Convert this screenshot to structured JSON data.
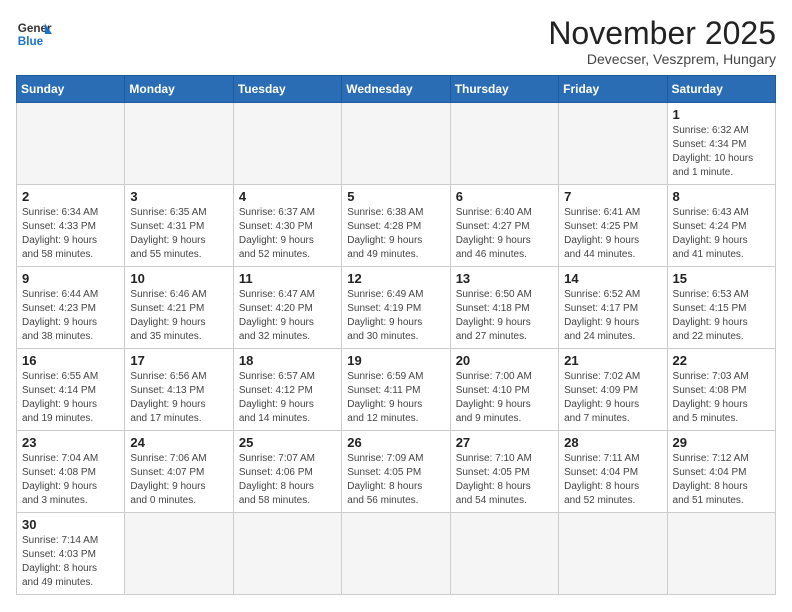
{
  "logo": {
    "general": "General",
    "blue": "Blue"
  },
  "title": "November 2025",
  "subtitle": "Devecser, Veszprem, Hungary",
  "days_of_week": [
    "Sunday",
    "Monday",
    "Tuesday",
    "Wednesday",
    "Thursday",
    "Friday",
    "Saturday"
  ],
  "weeks": [
    [
      {
        "day": "",
        "info": "",
        "empty": true
      },
      {
        "day": "",
        "info": "",
        "empty": true
      },
      {
        "day": "",
        "info": "",
        "empty": true
      },
      {
        "day": "",
        "info": "",
        "empty": true
      },
      {
        "day": "",
        "info": "",
        "empty": true
      },
      {
        "day": "",
        "info": "",
        "empty": true
      },
      {
        "day": "1",
        "info": "Sunrise: 6:32 AM\nSunset: 4:34 PM\nDaylight: 10 hours\nand 1 minute.",
        "empty": false
      }
    ],
    [
      {
        "day": "2",
        "info": "Sunrise: 6:34 AM\nSunset: 4:33 PM\nDaylight: 9 hours\nand 58 minutes.",
        "empty": false
      },
      {
        "day": "3",
        "info": "Sunrise: 6:35 AM\nSunset: 4:31 PM\nDaylight: 9 hours\nand 55 minutes.",
        "empty": false
      },
      {
        "day": "4",
        "info": "Sunrise: 6:37 AM\nSunset: 4:30 PM\nDaylight: 9 hours\nand 52 minutes.",
        "empty": false
      },
      {
        "day": "5",
        "info": "Sunrise: 6:38 AM\nSunset: 4:28 PM\nDaylight: 9 hours\nand 49 minutes.",
        "empty": false
      },
      {
        "day": "6",
        "info": "Sunrise: 6:40 AM\nSunset: 4:27 PM\nDaylight: 9 hours\nand 46 minutes.",
        "empty": false
      },
      {
        "day": "7",
        "info": "Sunrise: 6:41 AM\nSunset: 4:25 PM\nDaylight: 9 hours\nand 44 minutes.",
        "empty": false
      },
      {
        "day": "8",
        "info": "Sunrise: 6:43 AM\nSunset: 4:24 PM\nDaylight: 9 hours\nand 41 minutes.",
        "empty": false
      }
    ],
    [
      {
        "day": "9",
        "info": "Sunrise: 6:44 AM\nSunset: 4:23 PM\nDaylight: 9 hours\nand 38 minutes.",
        "empty": false
      },
      {
        "day": "10",
        "info": "Sunrise: 6:46 AM\nSunset: 4:21 PM\nDaylight: 9 hours\nand 35 minutes.",
        "empty": false
      },
      {
        "day": "11",
        "info": "Sunrise: 6:47 AM\nSunset: 4:20 PM\nDaylight: 9 hours\nand 32 minutes.",
        "empty": false
      },
      {
        "day": "12",
        "info": "Sunrise: 6:49 AM\nSunset: 4:19 PM\nDaylight: 9 hours\nand 30 minutes.",
        "empty": false
      },
      {
        "day": "13",
        "info": "Sunrise: 6:50 AM\nSunset: 4:18 PM\nDaylight: 9 hours\nand 27 minutes.",
        "empty": false
      },
      {
        "day": "14",
        "info": "Sunrise: 6:52 AM\nSunset: 4:17 PM\nDaylight: 9 hours\nand 24 minutes.",
        "empty": false
      },
      {
        "day": "15",
        "info": "Sunrise: 6:53 AM\nSunset: 4:15 PM\nDaylight: 9 hours\nand 22 minutes.",
        "empty": false
      }
    ],
    [
      {
        "day": "16",
        "info": "Sunrise: 6:55 AM\nSunset: 4:14 PM\nDaylight: 9 hours\nand 19 minutes.",
        "empty": false
      },
      {
        "day": "17",
        "info": "Sunrise: 6:56 AM\nSunset: 4:13 PM\nDaylight: 9 hours\nand 17 minutes.",
        "empty": false
      },
      {
        "day": "18",
        "info": "Sunrise: 6:57 AM\nSunset: 4:12 PM\nDaylight: 9 hours\nand 14 minutes.",
        "empty": false
      },
      {
        "day": "19",
        "info": "Sunrise: 6:59 AM\nSunset: 4:11 PM\nDaylight: 9 hours\nand 12 minutes.",
        "empty": false
      },
      {
        "day": "20",
        "info": "Sunrise: 7:00 AM\nSunset: 4:10 PM\nDaylight: 9 hours\nand 9 minutes.",
        "empty": false
      },
      {
        "day": "21",
        "info": "Sunrise: 7:02 AM\nSunset: 4:09 PM\nDaylight: 9 hours\nand 7 minutes.",
        "empty": false
      },
      {
        "day": "22",
        "info": "Sunrise: 7:03 AM\nSunset: 4:08 PM\nDaylight: 9 hours\nand 5 minutes.",
        "empty": false
      }
    ],
    [
      {
        "day": "23",
        "info": "Sunrise: 7:04 AM\nSunset: 4:08 PM\nDaylight: 9 hours\nand 3 minutes.",
        "empty": false
      },
      {
        "day": "24",
        "info": "Sunrise: 7:06 AM\nSunset: 4:07 PM\nDaylight: 9 hours\nand 0 minutes.",
        "empty": false
      },
      {
        "day": "25",
        "info": "Sunrise: 7:07 AM\nSunset: 4:06 PM\nDaylight: 8 hours\nand 58 minutes.",
        "empty": false
      },
      {
        "day": "26",
        "info": "Sunrise: 7:09 AM\nSunset: 4:05 PM\nDaylight: 8 hours\nand 56 minutes.",
        "empty": false
      },
      {
        "day": "27",
        "info": "Sunrise: 7:10 AM\nSunset: 4:05 PM\nDaylight: 8 hours\nand 54 minutes.",
        "empty": false
      },
      {
        "day": "28",
        "info": "Sunrise: 7:11 AM\nSunset: 4:04 PM\nDaylight: 8 hours\nand 52 minutes.",
        "empty": false
      },
      {
        "day": "29",
        "info": "Sunrise: 7:12 AM\nSunset: 4:04 PM\nDaylight: 8 hours\nand 51 minutes.",
        "empty": false
      }
    ],
    [
      {
        "day": "30",
        "info": "Sunrise: 7:14 AM\nSunset: 4:03 PM\nDaylight: 8 hours\nand 49 minutes.",
        "empty": false
      },
      {
        "day": "",
        "info": "",
        "empty": true
      },
      {
        "day": "",
        "info": "",
        "empty": true
      },
      {
        "day": "",
        "info": "",
        "empty": true
      },
      {
        "day": "",
        "info": "",
        "empty": true
      },
      {
        "day": "",
        "info": "",
        "empty": true
      },
      {
        "day": "",
        "info": "",
        "empty": true
      }
    ]
  ]
}
